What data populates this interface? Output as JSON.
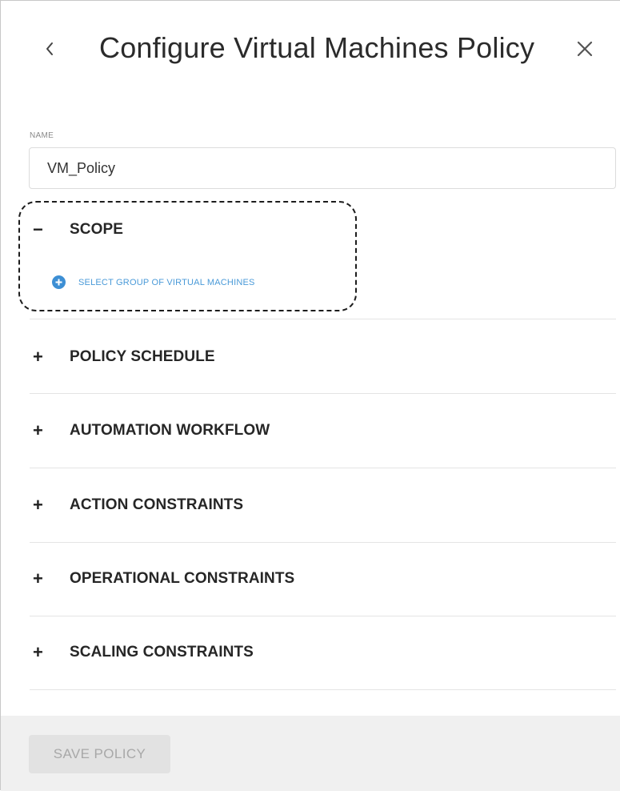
{
  "header": {
    "title": "Configure Virtual Machines Policy",
    "back_icon": "chevron-left-icon",
    "close_icon": "close-icon"
  },
  "name_field": {
    "label": "NAME",
    "value": "VM_Policy"
  },
  "sections": [
    {
      "title": "SCOPE",
      "expanded": true,
      "sign": "−"
    },
    {
      "title": "POLICY SCHEDULE",
      "expanded": false,
      "sign": "+"
    },
    {
      "title": "AUTOMATION WORKFLOW",
      "expanded": false,
      "sign": "+"
    },
    {
      "title": "ACTION CONSTRAINTS",
      "expanded": false,
      "sign": "+"
    },
    {
      "title": "OPERATIONAL CONSTRAINTS",
      "expanded": false,
      "sign": "+"
    },
    {
      "title": "SCALING CONSTRAINTS",
      "expanded": false,
      "sign": "+"
    }
  ],
  "scope": {
    "select_group_label": "SELECT GROUP OF VIRTUAL MACHINES",
    "select_group_icon": "plus-circle-icon"
  },
  "footer": {
    "save_label": "SAVE POLICY",
    "save_enabled": false
  },
  "colors": {
    "link": "#4a9ad8",
    "icon_accent": "#3d8fd4",
    "footer_bg": "#f0f0f0",
    "disabled_button_bg": "#e2e2e2"
  }
}
